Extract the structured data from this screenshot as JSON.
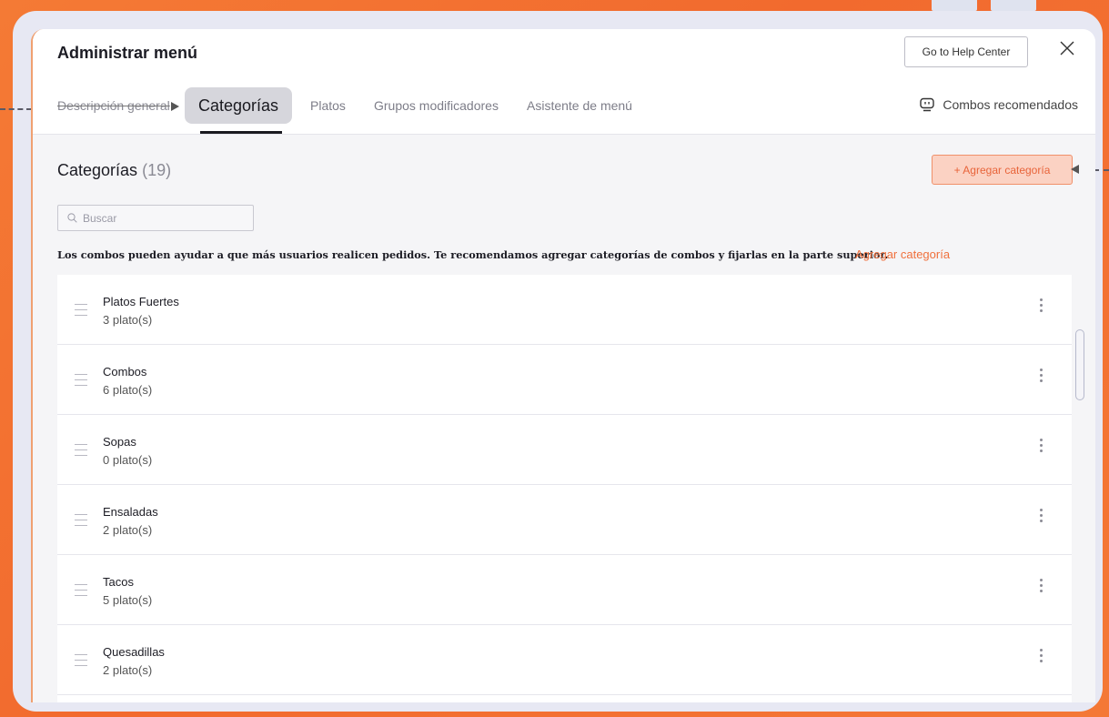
{
  "header": {
    "title": "Administrar menú",
    "help_button": "Go to Help Center",
    "close_icon": "close-icon"
  },
  "tabs": [
    {
      "label": "Descripción general",
      "active": false
    },
    {
      "label": "Categorías",
      "active": true
    },
    {
      "label": "Platos",
      "active": false
    },
    {
      "label": "Grupos modificadores",
      "active": false
    },
    {
      "label": "Asistente de menú",
      "active": false
    }
  ],
  "combos_recommended": {
    "label": "Combos recomendados",
    "icon": "robot-icon"
  },
  "categories_section": {
    "heading": "Categorías",
    "count": "(19)",
    "add_button": "+ Agregar categoría",
    "search_placeholder": "Buscar",
    "notice": "Los combos pueden ayudar a que más usuarios realicen pedidos. Te recomendamos agregar categorías de combos y fijarlas en la parte superior.",
    "notice_link": "Agregar categoría"
  },
  "categories": [
    {
      "name": "Platos Fuertes",
      "count": "3 plato(s)"
    },
    {
      "name": "Combos",
      "count": "6 plato(s)"
    },
    {
      "name": "Sopas",
      "count": "0 plato(s)"
    },
    {
      "name": "Ensaladas",
      "count": "2 plato(s)"
    },
    {
      "name": "Tacos",
      "count": "5 plato(s)"
    },
    {
      "name": "Quesadillas",
      "count": "2 plato(s)"
    }
  ],
  "colors": {
    "accent": "#f0703c",
    "background": "#f47a35",
    "add_button_bg": "#fbd2c3"
  }
}
